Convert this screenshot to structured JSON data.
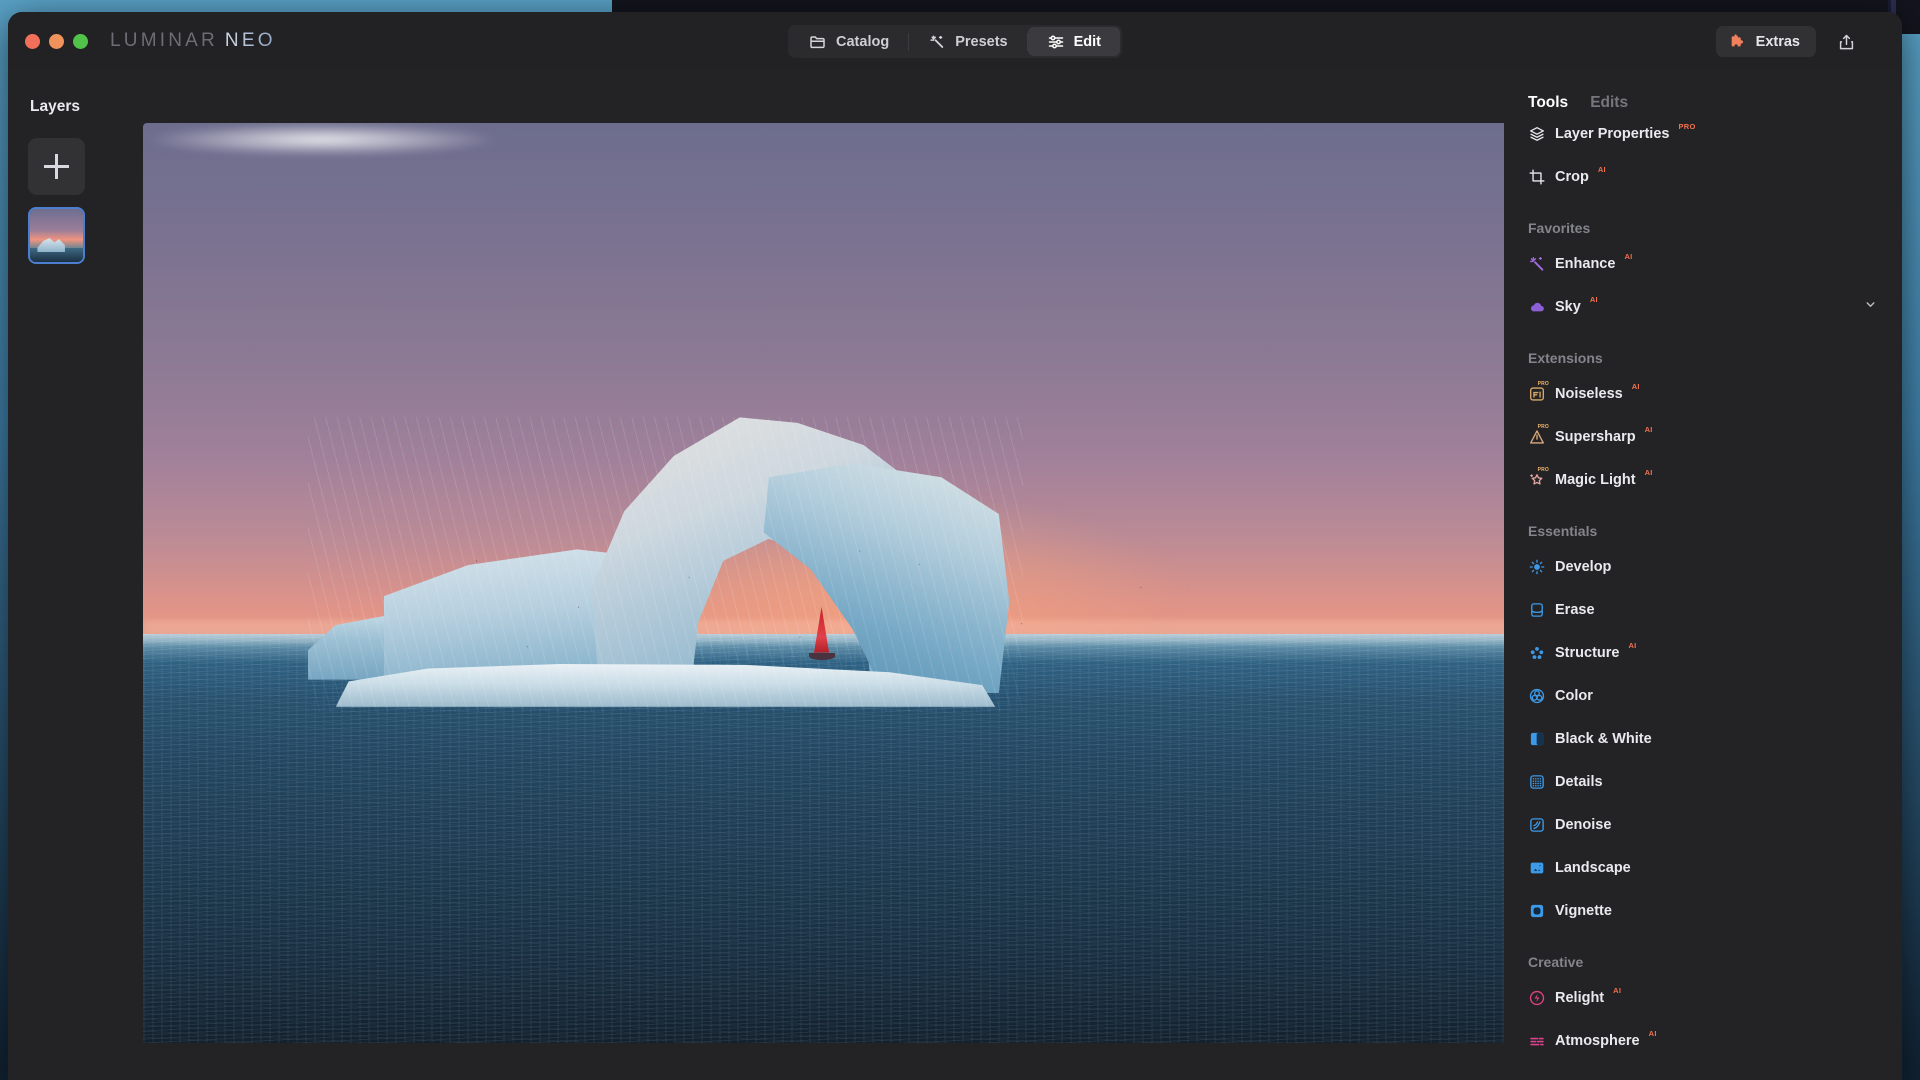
{
  "app": {
    "brand_first": "LUMINAR",
    "brand_second": "NEO",
    "window_controls": [
      "close",
      "minimize",
      "maximize"
    ]
  },
  "titlebar": {
    "tabs": [
      {
        "label": "Catalog",
        "icon": "folder-icon",
        "active": false
      },
      {
        "label": "Presets",
        "icon": "sparkle-icon",
        "active": false
      },
      {
        "label": "Edit",
        "icon": "sliders-icon",
        "active": true
      }
    ],
    "extras": {
      "label": "Extras",
      "icon": "puzzle-icon"
    },
    "share": {
      "icon": "share-icon"
    }
  },
  "layers": {
    "title": "Layers",
    "add_button": "+",
    "thumbnails": [
      {
        "name": "iceberg-layer",
        "selected": true
      }
    ]
  },
  "tools_panel": {
    "tabs": [
      {
        "label": "Tools",
        "active": true
      },
      {
        "label": "Edits",
        "active": false
      }
    ],
    "top_items": [
      {
        "label": "Layer Properties",
        "icon": "layers-icon",
        "badge": "PRO",
        "badge_type": "pro",
        "color": "#e8e8ee"
      },
      {
        "label": "Crop",
        "icon": "crop-icon",
        "badge": "AI",
        "badge_type": "ai",
        "color": "#e8e8ee"
      }
    ],
    "sections": [
      {
        "title": "Favorites",
        "items": [
          {
            "label": "Enhance",
            "icon": "enhance-sparkle-icon",
            "badge": "AI",
            "badge_type": "ai",
            "color": "#a06bdd",
            "chevron": false
          },
          {
            "label": "Sky",
            "icon": "sky-cloud-icon",
            "badge": "AI",
            "badge_type": "ai",
            "color": "#8b5fd6",
            "chevron": true
          }
        ]
      },
      {
        "title": "Extensions",
        "items": [
          {
            "label": "Noiseless",
            "icon": "noiseless-icon",
            "badge": "AI",
            "badge_type": "ai",
            "icon_pro": true,
            "color": "#d8a96b",
            "chevron": false
          },
          {
            "label": "Supersharp",
            "icon": "supersharp-icon",
            "badge": "AI",
            "badge_type": "ai",
            "icon_pro": true,
            "color": "#dba97e",
            "chevron": false
          },
          {
            "label": "Magic Light",
            "icon": "magic-light-icon",
            "badge": "AI",
            "badge_type": "ai",
            "icon_pro": true,
            "color": "#e0a4a0",
            "chevron": false
          }
        ]
      },
      {
        "title": "Essentials",
        "items": [
          {
            "label": "Develop",
            "icon": "develop-sun-icon",
            "badge": "",
            "badge_type": "",
            "color": "#3d9ae8",
            "chevron": false
          },
          {
            "label": "Erase",
            "icon": "erase-icon",
            "badge": "",
            "badge_type": "",
            "color": "#3d9ae8",
            "chevron": false
          },
          {
            "label": "Structure",
            "icon": "structure-icon",
            "badge": "AI",
            "badge_type": "ai",
            "color": "#3d9ae8",
            "chevron": false
          },
          {
            "label": "Color",
            "icon": "color-wheel-icon",
            "badge": "",
            "badge_type": "",
            "color": "#3d9ae8",
            "chevron": false
          },
          {
            "label": "Black & White",
            "icon": "black-white-icon",
            "badge": "",
            "badge_type": "",
            "color": "#3d9ae8",
            "chevron": false
          },
          {
            "label": "Details",
            "icon": "details-icon",
            "badge": "",
            "badge_type": "",
            "color": "#3d9ae8",
            "chevron": false
          },
          {
            "label": "Denoise",
            "icon": "denoise-icon",
            "badge": "",
            "badge_type": "",
            "color": "#3d9ae8",
            "chevron": false
          },
          {
            "label": "Landscape",
            "icon": "landscape-icon",
            "badge": "",
            "badge_type": "",
            "color": "#3d9ae8",
            "chevron": false
          },
          {
            "label": "Vignette",
            "icon": "vignette-icon",
            "badge": "",
            "badge_type": "",
            "color": "#3d9ae8",
            "chevron": false
          }
        ]
      },
      {
        "title": "Creative",
        "items": [
          {
            "label": "Relight",
            "icon": "relight-icon",
            "badge": "AI",
            "badge_type": "ai",
            "color": "#e0447f",
            "chevron": false
          },
          {
            "label": "Atmosphere",
            "icon": "atmosphere-icon",
            "badge": "AI",
            "badge_type": "ai",
            "color": "#d9438b",
            "chevron": false
          }
        ]
      }
    ]
  },
  "canvas": {
    "image_name": "iceberg-arch-sunset-with-red-sailboat"
  },
  "colors": {
    "accent_orange": "#f2714f",
    "accent_purple": "#8b5fd6",
    "accent_blue": "#3d9ae8",
    "accent_pink": "#e0447f",
    "panel_bg": "#232325",
    "titlebar_bg": "#222224",
    "selection_blue": "#4d7fd1"
  }
}
